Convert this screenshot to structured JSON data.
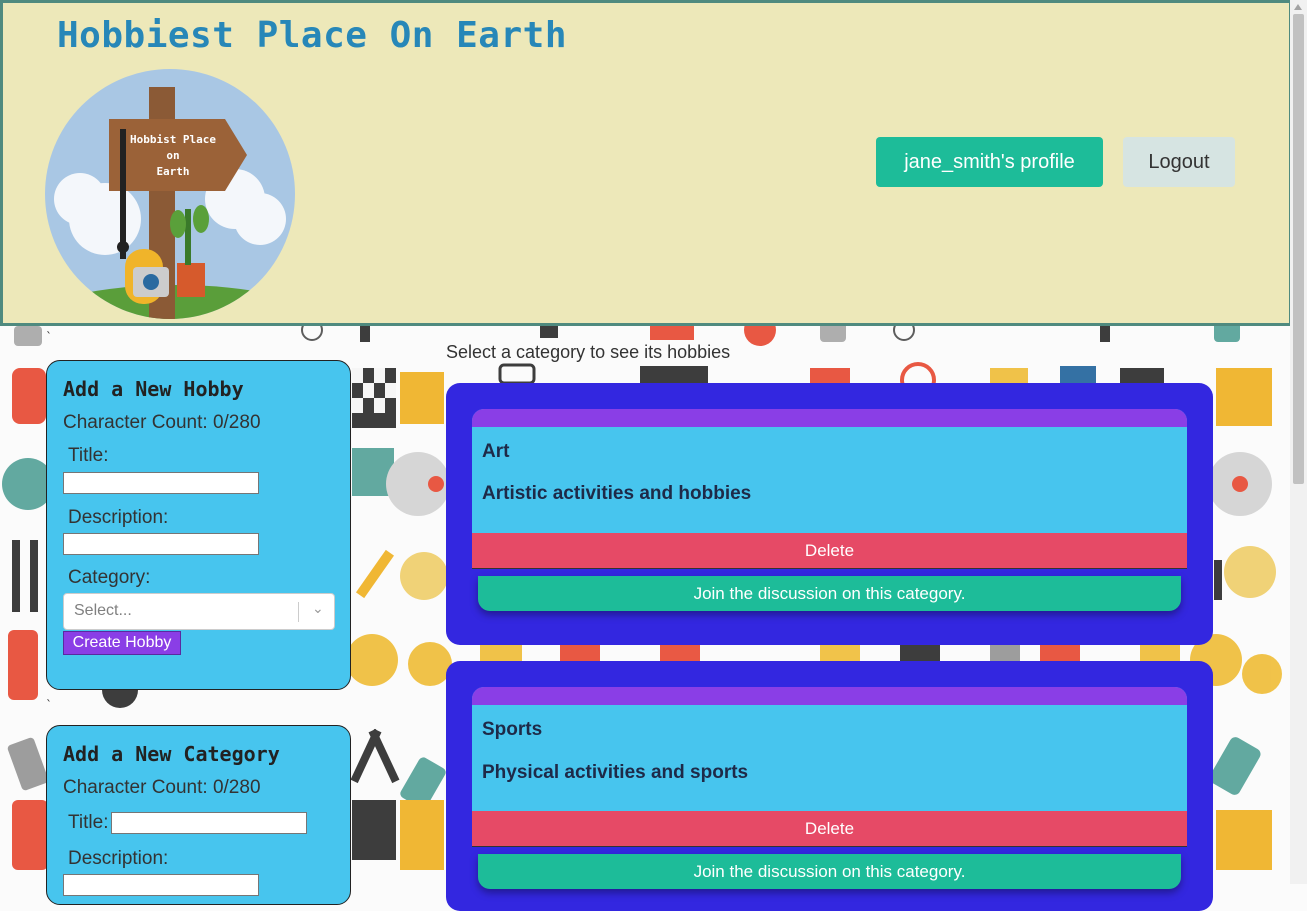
{
  "header": {
    "site_title": "Hobbiest Place On Earth",
    "logo_text_line1": "Hobbist Place",
    "logo_text_line2": "on",
    "logo_text_line3": "Earth",
    "profile_button": "jane_smith's profile",
    "logout_button": "Logout"
  },
  "hobby_form": {
    "heading": "Add a New Hobby",
    "char_count": "Character Count: 0/280",
    "title_label": "Title:",
    "title_value": "",
    "description_label": "Description:",
    "description_value": "",
    "category_label": "Category:",
    "category_placeholder": "Select...",
    "submit_label": "Create Hobby"
  },
  "category_form": {
    "heading": "Add a New Category",
    "char_count": "Character Count: 0/280",
    "title_label": "Title:",
    "title_value": "",
    "description_label": "Description:",
    "description_value": ""
  },
  "stray_mark": "`",
  "main": {
    "prompt": "Select a category to see its hobbies",
    "categories": [
      {
        "name": "Art",
        "description": "Artistic activities and hobbies",
        "delete_label": "Delete",
        "join_label": "Join the discussion on this category."
      },
      {
        "name": "Sports",
        "description": "Physical activities and sports",
        "delete_label": "Delete",
        "join_label": "Join the discussion on this category."
      }
    ]
  },
  "colors": {
    "header_bg": "#ede8b9",
    "header_border": "#4f8a7f",
    "title": "#2787b8",
    "panel": "#47c5ee",
    "category_frame": "#3327e0",
    "card_top": "#8a3ee6",
    "delete": "#e64a66",
    "join": "#1dbc99"
  }
}
